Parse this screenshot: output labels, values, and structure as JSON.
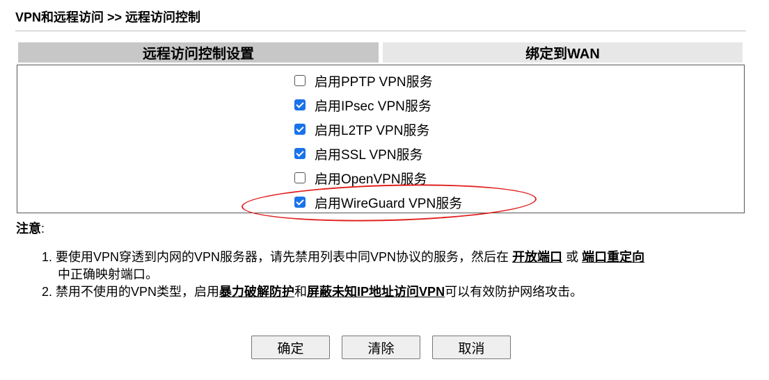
{
  "breadcrumb": "VPN和远程访问 >> 远程访问控制",
  "table": {
    "header_left": "远程访问控制设置",
    "header_right": "绑定到WAN"
  },
  "options": [
    {
      "label": "启用PPTP VPN服务",
      "checked": false
    },
    {
      "label": "启用IPsec VPN服务",
      "checked": true
    },
    {
      "label": "启用L2TP VPN服务",
      "checked": true
    },
    {
      "label": "启用SSL VPN服务",
      "checked": true
    },
    {
      "label": "启用OpenVPN服务",
      "checked": false
    },
    {
      "label": "启用WireGuard VPN服务",
      "checked": true
    }
  ],
  "notes": {
    "title": "注意",
    "title_colon": ":",
    "n1_num": "1.",
    "n1_text_a": "要使用VPN穿透到内网的VPN服务器，请先禁用列表中同VPN协议的服务，然后在 ",
    "n1_link1": "开放端口",
    "n1_text_b": " 或 ",
    "n1_link2": "端口重定向",
    "n1_text_c": "中正确映射端口。",
    "n2_num": "2.",
    "n2_text_a": "禁用不使用的VPN类型，启用",
    "n2_link1": "暴力破解防护",
    "n2_text_b": "和",
    "n2_link2": "屏蔽未知IP地址访问VPN",
    "n2_text_c": "可以有效防护网络攻击。"
  },
  "buttons": {
    "ok": "确定",
    "clear": "清除",
    "cancel": "取消"
  },
  "colors": {
    "checkbox_checked": "#1a73e8",
    "highlight_ellipse": "#e0201e",
    "header_left_bg": "#c7c7c7",
    "header_right_bg": "#e7e7e7"
  }
}
